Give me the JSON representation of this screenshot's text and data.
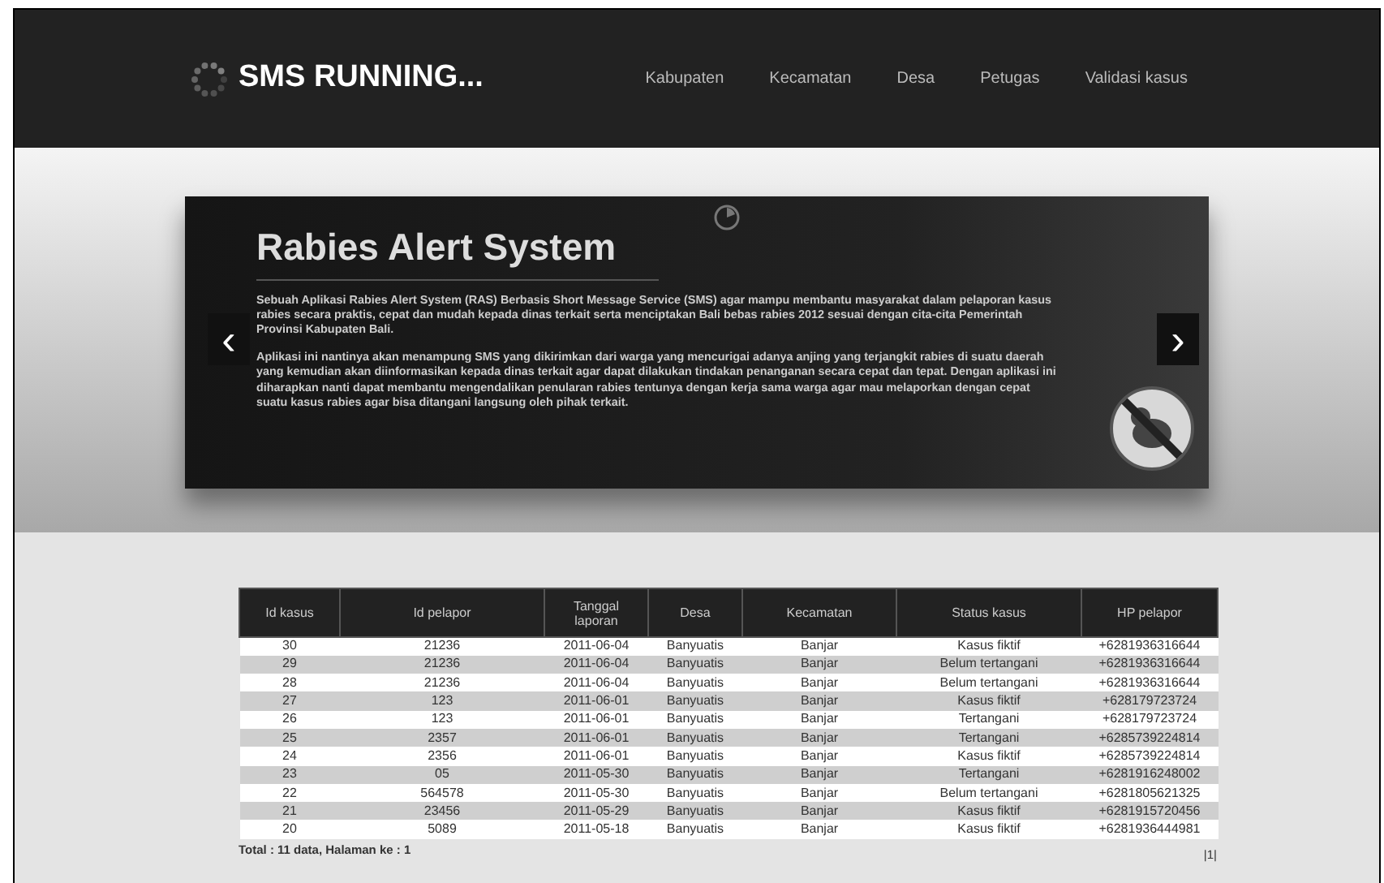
{
  "brand": "SMS RUNNING...",
  "nav": [
    "Kabupaten",
    "Kecamatan",
    "Desa",
    "Petugas",
    "Validasi kasus"
  ],
  "slide": {
    "title": "Rabies Alert System",
    "paragraphs": [
      "Sebuah  Aplikasi Rabies Alert System (RAS) Berbasis Short Message Service (SMS) agar mampu membantu masyarakat dalam pelaporan kasus rabies secara praktis, cepat  dan mudah kepada dinas terkait serta menciptakan Bali bebas rabies 2012 sesuai dengan cita-cita Pemerintah Provinsi Kabupaten Bali.",
      "Aplikasi ini nantinya akan menampung SMS yang dikirimkan dari warga yang mencurigai adanya anjing yang terjangkit rabies di suatu daerah yang kemudian akan diinformasikan kepada dinas terkait agar dapat dilakukan tindakan penanganan secara cepat dan tepat. Dengan aplikasi ini diharapkan nanti dapat membantu mengendalikan penularan rabies tentunya dengan kerja sama warga agar mau melaporkan dengan cepat suatu kasus rabies agar bisa ditangani langsung oleh pihak terkait."
    ],
    "prev": "‹",
    "next": "›"
  },
  "table": {
    "columns": [
      "Id kasus",
      "Id pelapor",
      "Tanggal laporan",
      "Desa",
      "Kecamatan",
      "Status kasus",
      "HP pelapor"
    ],
    "rows": [
      [
        "30",
        "21236",
        "2011-06-04",
        "Banyuatis",
        "Banjar",
        "Kasus fiktif",
        "+6281936316644"
      ],
      [
        "29",
        "21236",
        "2011-06-04",
        "Banyuatis",
        "Banjar",
        "Belum tertangani",
        "+6281936316644"
      ],
      [
        "28",
        "21236",
        "2011-06-04",
        "Banyuatis",
        "Banjar",
        "Belum tertangani",
        "+6281936316644"
      ],
      [
        "27",
        "123",
        "2011-06-01",
        "Banyuatis",
        "Banjar",
        "Kasus fiktif",
        "+628179723724"
      ],
      [
        "26",
        "123",
        "2011-06-01",
        "Banyuatis",
        "Banjar",
        "Tertangani",
        "+628179723724"
      ],
      [
        "25",
        "2357",
        "2011-06-01",
        "Banyuatis",
        "Banjar",
        "Tertangani",
        "+6285739224814"
      ],
      [
        "24",
        "2356",
        "2011-06-01",
        "Banyuatis",
        "Banjar",
        "Kasus fiktif",
        "+6285739224814"
      ],
      [
        "23",
        "05",
        "2011-05-30",
        "Banyuatis",
        "Banjar",
        "Tertangani",
        "+6281916248002"
      ],
      [
        "22",
        "564578",
        "2011-05-30",
        "Banyuatis",
        "Banjar",
        "Belum tertangani",
        "+6281805621325"
      ],
      [
        "21",
        "23456",
        "2011-05-29",
        "Banyuatis",
        "Banjar",
        "Kasus fiktif",
        "+6281915720456"
      ],
      [
        "20",
        "5089",
        "2011-05-18",
        "Banyuatis",
        "Banjar",
        "Kasus fiktif",
        "+6281936444981"
      ]
    ]
  },
  "footer": {
    "total": "Total : 11 data,  Halaman ke : 1",
    "pages": "|1|"
  }
}
